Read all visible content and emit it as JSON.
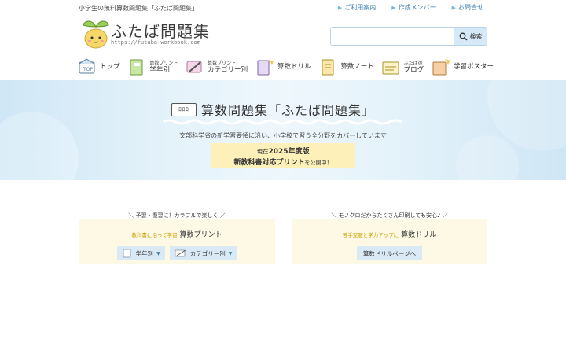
{
  "header": {
    "tagline": "小学生の無料算数問題集「ふたば問題集」",
    "links": [
      {
        "label": "ご利用案内"
      },
      {
        "label": "作成メンバー"
      },
      {
        "label": "お問合せ"
      }
    ],
    "logo_title": "ふたば問題集",
    "logo_url": "https://futaba-workbook.com",
    "search_placeholder": "",
    "search_button": "検索"
  },
  "nav": {
    "items": [
      {
        "small": "",
        "label": "トップ",
        "icon": "home-icon"
      },
      {
        "small": "算数プリント",
        "label": "学年別",
        "icon": "notebook-icon"
      },
      {
        "small": "算数プリント",
        "label": "カテゴリー別",
        "icon": "pencil-icon"
      },
      {
        "small": "",
        "label": "算数ドリル",
        "icon": "drill-book-icon"
      },
      {
        "small": "",
        "label": "算数ノート",
        "icon": "note-icon"
      },
      {
        "small": "ふたばの",
        "label": "ブログ",
        "icon": "blog-icon"
      },
      {
        "small": "",
        "label": "学習ポスター",
        "icon": "poster-icon"
      }
    ]
  },
  "hero": {
    "tag": "ﾛﾛﾛ",
    "title": "算数問題集「ふたば問題集」",
    "subtitle": "文部科学省の新学習要領に沿い、小学校で習う全分野をカバーしています",
    "box_prefix": "現在",
    "box_year": "2025年度版",
    "box_main": "新教科書対応プリント",
    "box_suffix": "を公開中！"
  },
  "cards": {
    "left": {
      "caption": "＼ 予習・復習に！カラフルで楽しく ／",
      "highlight": "教科書に沿って学習",
      "title": "算数プリント",
      "buttons": [
        {
          "label": "学年別"
        },
        {
          "label": "カテゴリー別"
        }
      ]
    },
    "right": {
      "caption": "＼ モノクロだからたくさん印刷しても安心♪ ／",
      "highlight": "苦手克服と学力アップに",
      "title": "算数ドリル",
      "button": "算数ドリルページへ"
    }
  },
  "colors": {
    "accent": "#3f7fb0",
    "hero_bg": "#d9eef9",
    "highlight_box": "#fdf1b9",
    "card_bg": "#fdf9e4",
    "button_bg": "#d9eaf6",
    "highlight_text": "#c89f00"
  }
}
